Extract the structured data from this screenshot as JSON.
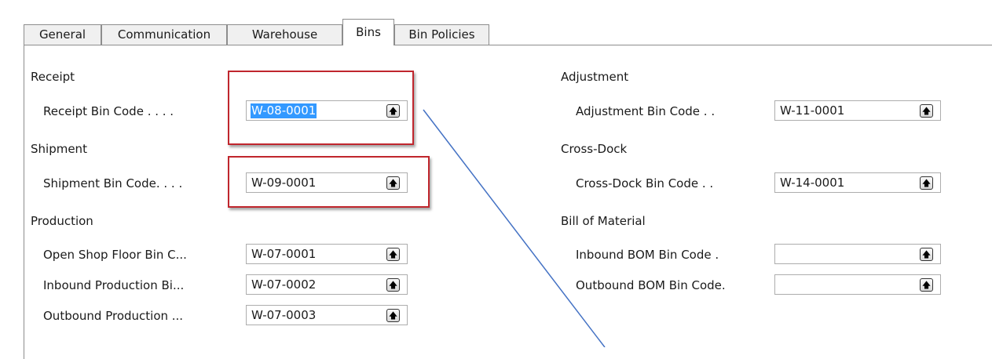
{
  "tabs": [
    {
      "label": "General"
    },
    {
      "label": "Communication"
    },
    {
      "label": "Warehouse"
    },
    {
      "label": "Bins"
    },
    {
      "label": "Bin Policies"
    }
  ],
  "active_tab": "Bins",
  "left": {
    "receipt": {
      "heading": "Receipt",
      "label": "Receipt Bin Code . . . .",
      "value": "W-08-0001"
    },
    "shipment": {
      "heading": "Shipment",
      "label": "Shipment Bin Code. . . .",
      "value": "W-09-0001"
    },
    "production": {
      "heading": "Production",
      "fields": [
        {
          "label": "Open Shop Floor Bin C...",
          "value": "W-07-0001"
        },
        {
          "label": "Inbound Production Bi...",
          "value": "W-07-0002"
        },
        {
          "label": "Outbound Production ...",
          "value": "W-07-0003"
        }
      ]
    }
  },
  "right": {
    "adjustment": {
      "heading": "Adjustment",
      "label": "Adjustment Bin Code . .",
      "value": "W-11-0001"
    },
    "crossdock": {
      "heading": "Cross-Dock",
      "label": "Cross-Dock Bin Code . .",
      "value": "W-14-0001"
    },
    "bom": {
      "heading": "Bill of Material",
      "fields": [
        {
          "label": "Inbound BOM Bin Code .",
          "value": ""
        },
        {
          "label": "Outbound BOM Bin Code.",
          "value": ""
        }
      ]
    }
  },
  "icons": {
    "lookup": "lookup-arrow-icon"
  },
  "colors": {
    "highlight": "#c0262d",
    "annotation_line": "#4472c4",
    "selection": "#3399ff"
  }
}
